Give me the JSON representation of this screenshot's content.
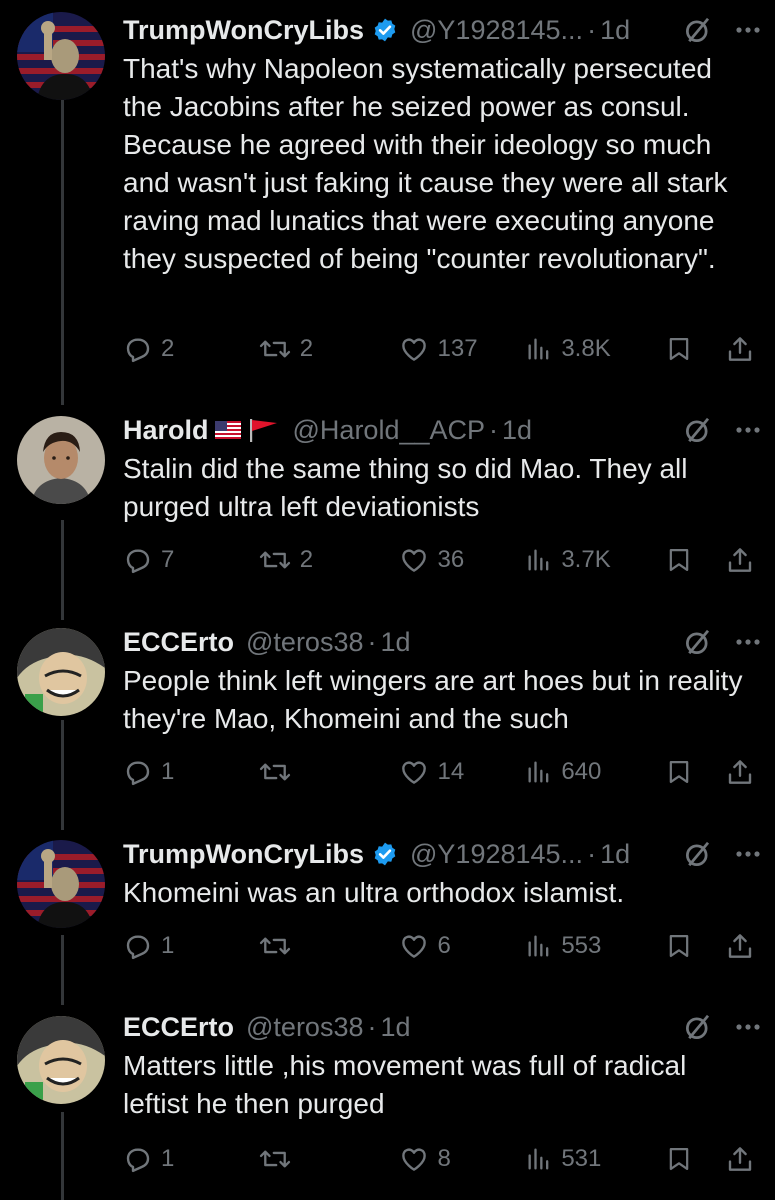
{
  "tweets": [
    {
      "name": "TrumpWonCryLibs",
      "handle": "@Y1928145...",
      "time": "1d",
      "verified": true,
      "text": "That's why Napoleon systematically persecuted the Jacobins after he seized power as consul. Because he agreed with their ideology so much and wasn't just faking it cause they were all stark raving mad lunatics that were executing anyone they suspected of being \"counter revolutionary\".",
      "replies": "2",
      "reposts": "2",
      "likes": "137",
      "views": "3.8K"
    },
    {
      "name": "Harold",
      "handle": "@Harold__ACP",
      "time": "1d",
      "verified": false,
      "text": "Stalin did the same thing so did Mao. They all purged ultra left deviationists",
      "replies": "7",
      "reposts": "2",
      "likes": "36",
      "views": "3.7K"
    },
    {
      "name": "ECCErto",
      "handle": "@teros38",
      "time": "1d",
      "verified": false,
      "text": "People think left wingers are art hoes but in reality they're Mao, Khomeini and the such",
      "replies": "1",
      "reposts": "",
      "likes": "14",
      "views": "640"
    },
    {
      "name": "TrumpWonCryLibs",
      "handle": "@Y1928145...",
      "time": "1d",
      "verified": true,
      "text": "Khomeini was an ultra orthodox islamist.",
      "replies": "1",
      "reposts": "",
      "likes": "6",
      "views": "553"
    },
    {
      "name": "ECCErto",
      "handle": "@teros38",
      "time": "1d",
      "verified": false,
      "text": "Matters little ,his movement was full of radical leftist he then purged",
      "replies": "1",
      "reposts": "",
      "likes": "8",
      "views": "531"
    }
  ],
  "separator": "·",
  "colors": {
    "background": "#000000",
    "text": "#e7e9ea",
    "muted": "#71767b",
    "verified": "#1d9bf0",
    "thread_line": "#333639"
  },
  "icons": [
    "reply-icon",
    "repost-icon",
    "like-icon",
    "views-icon",
    "bookmark-icon",
    "share-icon",
    "verified-badge-icon",
    "grok-icon",
    "more-icon",
    "us-flag-icon",
    "red-flag-icon"
  ]
}
